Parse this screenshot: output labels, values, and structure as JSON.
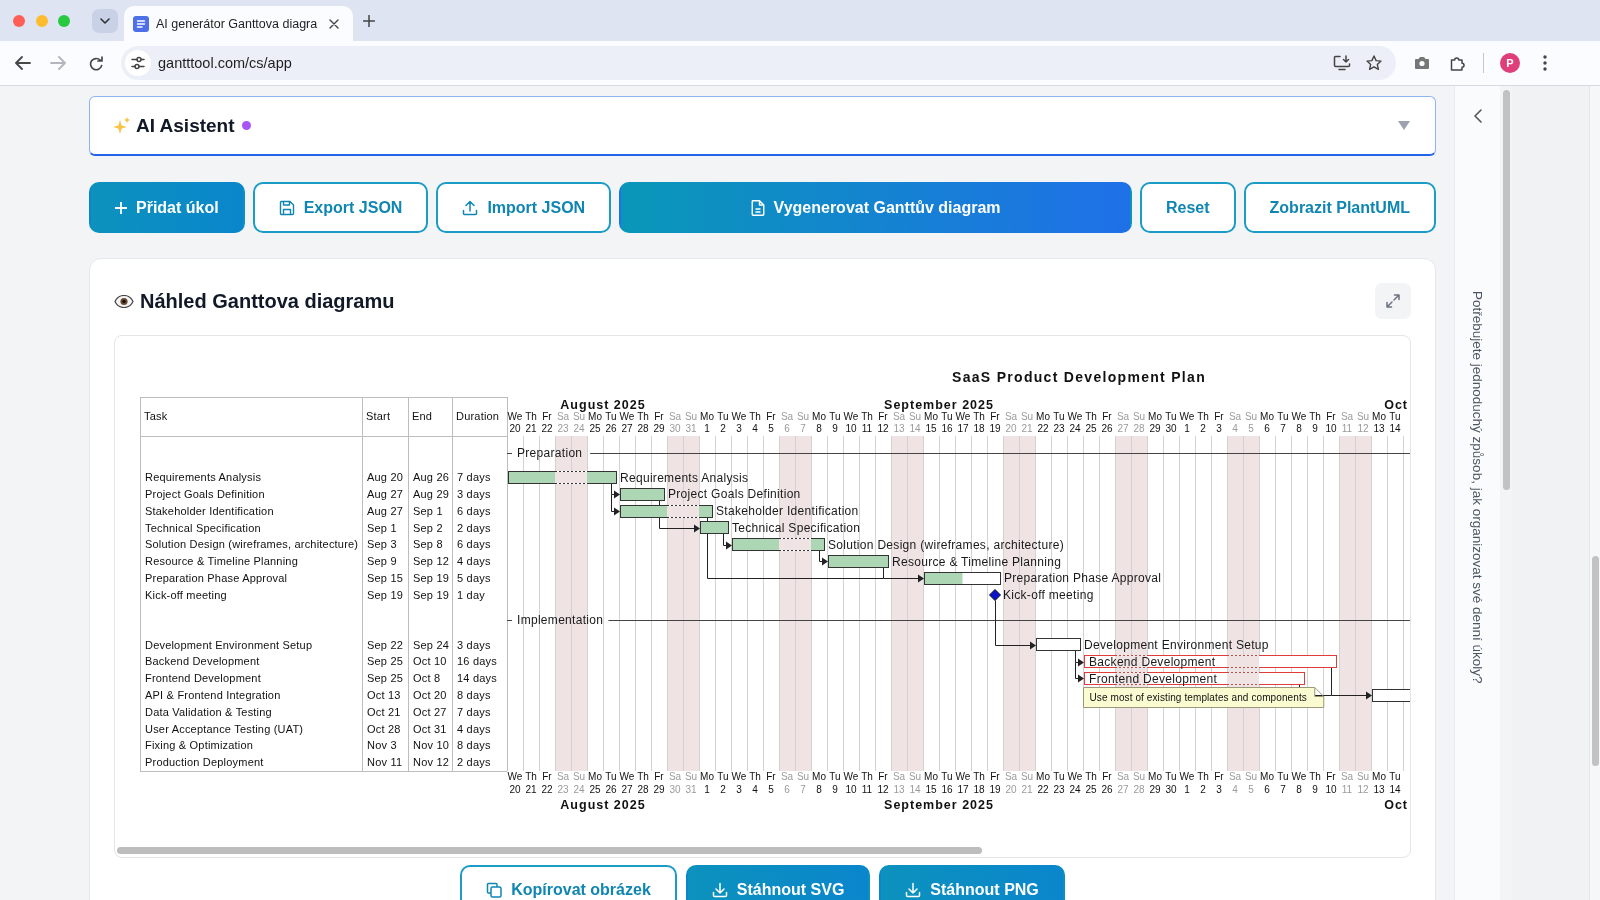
{
  "browser": {
    "tabs": [
      {
        "title": "AI generátor Ganttova diagra",
        "selected": true
      }
    ],
    "nav_buttons": [
      {
        "kind": "back",
        "disabled": false
      },
      {
        "kind": "forward",
        "disabled": true
      },
      {
        "kind": "reload",
        "disabled": false
      }
    ],
    "url": "gantttool.com/cs/app",
    "profile_initial": "P"
  },
  "assistant": {
    "title": "AI Asistent",
    "active": true,
    "expanded": false
  },
  "actions": [
    {
      "kind": "add",
      "label": "Přidat úkol"
    },
    {
      "kind": "export",
      "label": "Export JSON"
    },
    {
      "kind": "import",
      "label": "Import JSON"
    },
    {
      "kind": "generate",
      "label": "Vygenerovat Ganttův diagram"
    },
    {
      "kind": "reset",
      "label": "Reset"
    },
    {
      "kind": "plantuml",
      "label": "Zobrazit PlantUML"
    }
  ],
  "preview": {
    "title": "Náhled Ganttova diagramu",
    "gantt": {
      "title": "SaaS Product Development Plan",
      "columns": [
        "Task",
        "Start",
        "End",
        "Duration"
      ],
      "header": {
        "months": [
          {
            "label": "August 2025",
            "clipped": false,
            "days": [
              {
                "weekday": "We",
                "date": "20",
                "weekend": false
              },
              {
                "weekday": "Th",
                "date": "21",
                "weekend": false
              },
              {
                "weekday": "Fr",
                "date": "22",
                "weekend": false
              },
              {
                "weekday": "Sa",
                "date": "23",
                "weekend": true
              },
              {
                "weekday": "Su",
                "date": "24",
                "weekend": true
              },
              {
                "weekday": "Mo",
                "date": "25",
                "weekend": false
              },
              {
                "weekday": "Tu",
                "date": "26",
                "weekend": false
              },
              {
                "weekday": "We",
                "date": "27",
                "weekend": false
              },
              {
                "weekday": "Th",
                "date": "28",
                "weekend": false
              },
              {
                "weekday": "Fr",
                "date": "29",
                "weekend": false
              },
              {
                "weekday": "Sa",
                "date": "30",
                "weekend": true
              },
              {
                "weekday": "Su",
                "date": "31",
                "weekend": true
              }
            ]
          },
          {
            "label": "September 2025",
            "clipped": false,
            "days": [
              {
                "weekday": "Mo",
                "date": "1",
                "weekend": false
              },
              {
                "weekday": "Tu",
                "date": "2",
                "weekend": false
              },
              {
                "weekday": "We",
                "date": "3",
                "weekend": false
              },
              {
                "weekday": "Th",
                "date": "4",
                "weekend": false
              },
              {
                "weekday": "Fr",
                "date": "5",
                "weekend": false
              },
              {
                "weekday": "Sa",
                "date": "6",
                "weekend": true
              },
              {
                "weekday": "Su",
                "date": "7",
                "weekend": true
              },
              {
                "weekday": "Mo",
                "date": "8",
                "weekend": false
              },
              {
                "weekday": "Tu",
                "date": "9",
                "weekend": false
              },
              {
                "weekday": "We",
                "date": "10",
                "weekend": false
              },
              {
                "weekday": "Th",
                "date": "11",
                "weekend": false
              },
              {
                "weekday": "Fr",
                "date": "12",
                "weekend": false
              },
              {
                "weekday": "Sa",
                "date": "13",
                "weekend": true
              },
              {
                "weekday": "Su",
                "date": "14",
                "weekend": true
              },
              {
                "weekday": "Mo",
                "date": "15",
                "weekend": false
              },
              {
                "weekday": "Tu",
                "date": "16",
                "weekend": false
              },
              {
                "weekday": "We",
                "date": "17",
                "weekend": false
              },
              {
                "weekday": "Th",
                "date": "18",
                "weekend": false
              },
              {
                "weekday": "Fr",
                "date": "19",
                "weekend": false
              },
              {
                "weekday": "Sa",
                "date": "20",
                "weekend": true
              },
              {
                "weekday": "Su",
                "date": "21",
                "weekend": true
              },
              {
                "weekday": "Mo",
                "date": "22",
                "weekend": false
              },
              {
                "weekday": "Tu",
                "date": "23",
                "weekend": false
              },
              {
                "weekday": "We",
                "date": "24",
                "weekend": false
              },
              {
                "weekday": "Th",
                "date": "25",
                "weekend": false
              },
              {
                "weekday": "Fr",
                "date": "26",
                "weekend": false
              },
              {
                "weekday": "Sa",
                "date": "27",
                "weekend": true
              },
              {
                "weekday": "Su",
                "date": "28",
                "weekend": true
              },
              {
                "weekday": "Mo",
                "date": "29",
                "weekend": false
              },
              {
                "weekday": "Tu",
                "date": "30",
                "weekend": false
              }
            ]
          },
          {
            "label": "Oct",
            "clipped": true,
            "days": [
              {
                "weekday": "We",
                "date": "1",
                "weekend": false
              },
              {
                "weekday": "Th",
                "date": "2",
                "weekend": false
              },
              {
                "weekday": "Fr",
                "date": "3",
                "weekend": false
              },
              {
                "weekday": "Sa",
                "date": "4",
                "weekend": true
              },
              {
                "weekday": "Su",
                "date": "5",
                "weekend": true
              },
              {
                "weekday": "Mo",
                "date": "6",
                "weekend": false
              },
              {
                "weekday": "Tu",
                "date": "7",
                "weekend": false
              },
              {
                "weekday": "We",
                "date": "8",
                "weekend": false
              },
              {
                "weekday": "Th",
                "date": "9",
                "weekend": false
              },
              {
                "weekday": "Fr",
                "date": "10",
                "weekend": false
              },
              {
                "weekday": "Sa",
                "date": "11",
                "weekend": true
              },
              {
                "weekday": "Su",
                "date": "12",
                "weekend": true
              },
              {
                "weekday": "Mo",
                "date": "13",
                "weekend": false
              },
              {
                "weekday": "Tu",
                "date": "14",
                "weekend": false
              }
            ]
          }
        ]
      },
      "rows": [
        {
          "kind": "group",
          "label": "Preparation"
        },
        {
          "kind": "task",
          "cells": [
            "Requirements Analysis",
            "Aug 20",
            "Aug 26",
            "7 days"
          ],
          "bar": {
            "label": "Requirements Analysis",
            "level": 1,
            "highlighted": false
          }
        },
        {
          "kind": "task",
          "cells": [
            "Project Goals Definition",
            "Aug 27",
            "Aug 29",
            "3 days"
          ],
          "bar": {
            "label": "Project Goals Definition",
            "level": 1,
            "highlighted": false
          }
        },
        {
          "kind": "task",
          "cells": [
            "Stakeholder Identification",
            "Aug 27",
            "Sep 1",
            "6 days"
          ],
          "bar": {
            "label": "Stakeholder Identification",
            "level": 1,
            "highlighted": false
          }
        },
        {
          "kind": "task",
          "cells": [
            "Technical Specification",
            "Sep 1",
            "Sep 2",
            "2 days"
          ],
          "bar": {
            "label": "Technical Specification",
            "level": 1,
            "highlighted": false
          }
        },
        {
          "kind": "task",
          "cells": [
            "Solution Design (wireframes, architecture)",
            "Sep 3",
            "Sep 8",
            "6 days"
          ],
          "bar": {
            "label": "Solution Design (wireframes, architecture)",
            "level": 1,
            "highlighted": false
          }
        },
        {
          "kind": "task",
          "cells": [
            "Resource & Timeline Planning",
            "Sep 9",
            "Sep 12",
            "4 days"
          ],
          "bar": {
            "label": "Resource & Timeline Planning",
            "level": 1,
            "highlighted": false
          }
        },
        {
          "kind": "task",
          "cells": [
            "Preparation Phase Approval",
            "Sep 15",
            "Sep 19",
            "5 days"
          ],
          "bar": {
            "label": "Preparation Phase Approval",
            "level": 0.5,
            "highlighted": false
          }
        },
        {
          "kind": "milestone",
          "cells": [
            "Kick-off meeting",
            "Sep 19",
            "Sep 19",
            "1 day"
          ],
          "bar": {
            "label": "Kick-off meeting"
          }
        },
        {
          "kind": "group",
          "label": "Implementation"
        },
        {
          "kind": "task",
          "cells": [
            "Development Environment Setup",
            "Sep 22",
            "Sep 24",
            "3 days"
          ],
          "bar": {
            "label": "Development Environment Setup",
            "highlighted": false
          }
        },
        {
          "kind": "task",
          "cells": [
            "Backend Development",
            "Sep 25",
            "Oct 10",
            "16 days"
          ],
          "bar": {
            "label": "Backend Development",
            "highlighted": true
          }
        },
        {
          "kind": "task",
          "cells": [
            "Frontend Development",
            "Sep 25",
            "Oct 8",
            "14 days"
          ],
          "bar": {
            "label": "Frontend Development",
            "highlighted": true,
            "note": "Use most of existing templates and components"
          }
        },
        {
          "kind": "task",
          "cells": [
            "API & Frontend Integration",
            "Oct 13",
            "Oct 20",
            "8 days"
          ],
          "bar": {
            "highlighted": false
          }
        },
        {
          "kind": "task",
          "cells": [
            "Data Validation & Testing",
            "Oct 21",
            "Oct 27",
            "7 days"
          ]
        },
        {
          "kind": "task",
          "cells": [
            "User Acceptance Testing (UAT)",
            "Oct 28",
            "Oct 31",
            "4 days"
          ]
        },
        {
          "kind": "task",
          "cells": [
            "Fixing & Optimization",
            "Nov 3",
            "Nov 10",
            "8 days"
          ]
        },
        {
          "kind": "task",
          "cells": [
            "Production Deployment",
            "Nov 11",
            "Nov 12",
            "2 days"
          ]
        }
      ],
      "footer": {
        "months": [
          {
            "label": "August 2025",
            "clipped": false,
            "days": [
              {
                "weekday": "We",
                "date": "20",
                "weekend": false
              },
              {
                "weekday": "Th",
                "date": "21",
                "weekend": false
              },
              {
                "weekday": "Fr",
                "date": "22",
                "weekend": false
              },
              {
                "weekday": "Sa",
                "date": "23",
                "weekend": true
              },
              {
                "weekday": "Su",
                "date": "24",
                "weekend": true
              },
              {
                "weekday": "Mo",
                "date": "25",
                "weekend": false
              },
              {
                "weekday": "Tu",
                "date": "26",
                "weekend": false
              },
              {
                "weekday": "We",
                "date": "27",
                "weekend": false
              },
              {
                "weekday": "Th",
                "date": "28",
                "weekend": false
              },
              {
                "weekday": "Fr",
                "date": "29",
                "weekend": false
              },
              {
                "weekday": "Sa",
                "date": "30",
                "weekend": true
              },
              {
                "weekday": "Su",
                "date": "31",
                "weekend": true
              }
            ]
          },
          {
            "label": "September 2025",
            "clipped": false,
            "days": [
              {
                "weekday": "Mo",
                "date": "1",
                "weekend": false
              },
              {
                "weekday": "Tu",
                "date": "2",
                "weekend": false
              },
              {
                "weekday": "We",
                "date": "3",
                "weekend": false
              },
              {
                "weekday": "Th",
                "date": "4",
                "weekend": false
              },
              {
                "weekday": "Fr",
                "date": "5",
                "weekend": false
              },
              {
                "weekday": "Sa",
                "date": "6",
                "weekend": true
              },
              {
                "weekday": "Su",
                "date": "7",
                "weekend": true
              },
              {
                "weekday": "Mo",
                "date": "8",
                "weekend": false
              },
              {
                "weekday": "Tu",
                "date": "9",
                "weekend": false
              },
              {
                "weekday": "We",
                "date": "10",
                "weekend": false
              },
              {
                "weekday": "Th",
                "date": "11",
                "weekend": false
              },
              {
                "weekday": "Fr",
                "date": "12",
                "weekend": false
              },
              {
                "weekday": "Sa",
                "date": "13",
                "weekend": true
              },
              {
                "weekday": "Su",
                "date": "14",
                "weekend": true
              },
              {
                "weekday": "Mo",
                "date": "15",
                "weekend": false
              },
              {
                "weekday": "Tu",
                "date": "16",
                "weekend": false
              },
              {
                "weekday": "We",
                "date": "17",
                "weekend": false
              },
              {
                "weekday": "Th",
                "date": "18",
                "weekend": false
              },
              {
                "weekday": "Fr",
                "date": "19",
                "weekend": false
              },
              {
                "weekday": "Sa",
                "date": "20",
                "weekend": true
              },
              {
                "weekday": "Su",
                "date": "21",
                "weekend": true
              },
              {
                "weekday": "Mo",
                "date": "22",
                "weekend": false
              },
              {
                "weekday": "Tu",
                "date": "23",
                "weekend": false
              },
              {
                "weekday": "We",
                "date": "24",
                "weekend": false
              },
              {
                "weekday": "Th",
                "date": "25",
                "weekend": false
              },
              {
                "weekday": "Fr",
                "date": "26",
                "weekend": false
              },
              {
                "weekday": "Sa",
                "date": "27",
                "weekend": true
              },
              {
                "weekday": "Su",
                "date": "28",
                "weekend": true
              },
              {
                "weekday": "Mo",
                "date": "29",
                "weekend": false
              },
              {
                "weekday": "Tu",
                "date": "30",
                "weekend": false
              }
            ]
          },
          {
            "label": "Oct",
            "clipped": true,
            "days": [
              {
                "weekday": "We",
                "date": "1",
                "weekend": false
              },
              {
                "weekday": "Th",
                "date": "2",
                "weekend": false
              },
              {
                "weekday": "Fr",
                "date": "3",
                "weekend": false
              },
              {
                "weekday": "Sa",
                "date": "4",
                "weekend": true
              },
              {
                "weekday": "Su",
                "date": "5",
                "weekend": true
              },
              {
                "weekday": "Mo",
                "date": "6",
                "weekend": false
              },
              {
                "weekday": "Tu",
                "date": "7",
                "weekend": false
              },
              {
                "weekday": "We",
                "date": "8",
                "weekend": false
              },
              {
                "weekday": "Th",
                "date": "9",
                "weekend": false
              },
              {
                "weekday": "Fr",
                "date": "10",
                "weekend": false
              },
              {
                "weekday": "Sa",
                "date": "11",
                "weekend": true
              },
              {
                "weekday": "Su",
                "date": "12",
                "weekend": true
              },
              {
                "weekday": "Mo",
                "date": "13",
                "weekend": false
              },
              {
                "weekday": "Tu",
                "date": "14",
                "weekend": false
              }
            ]
          }
        ]
      }
    },
    "actions": [
      {
        "kind": "copy",
        "label": "Kopírovat obrázek"
      },
      {
        "kind": "download",
        "label": "Stáhnout SVG"
      },
      {
        "kind": "download",
        "label": "Stáhnout PNG"
      }
    ]
  },
  "sidebar": {
    "prompt": "Potřebujete jednoduchý způsob, jak organizovat své denní úkoly?"
  }
}
